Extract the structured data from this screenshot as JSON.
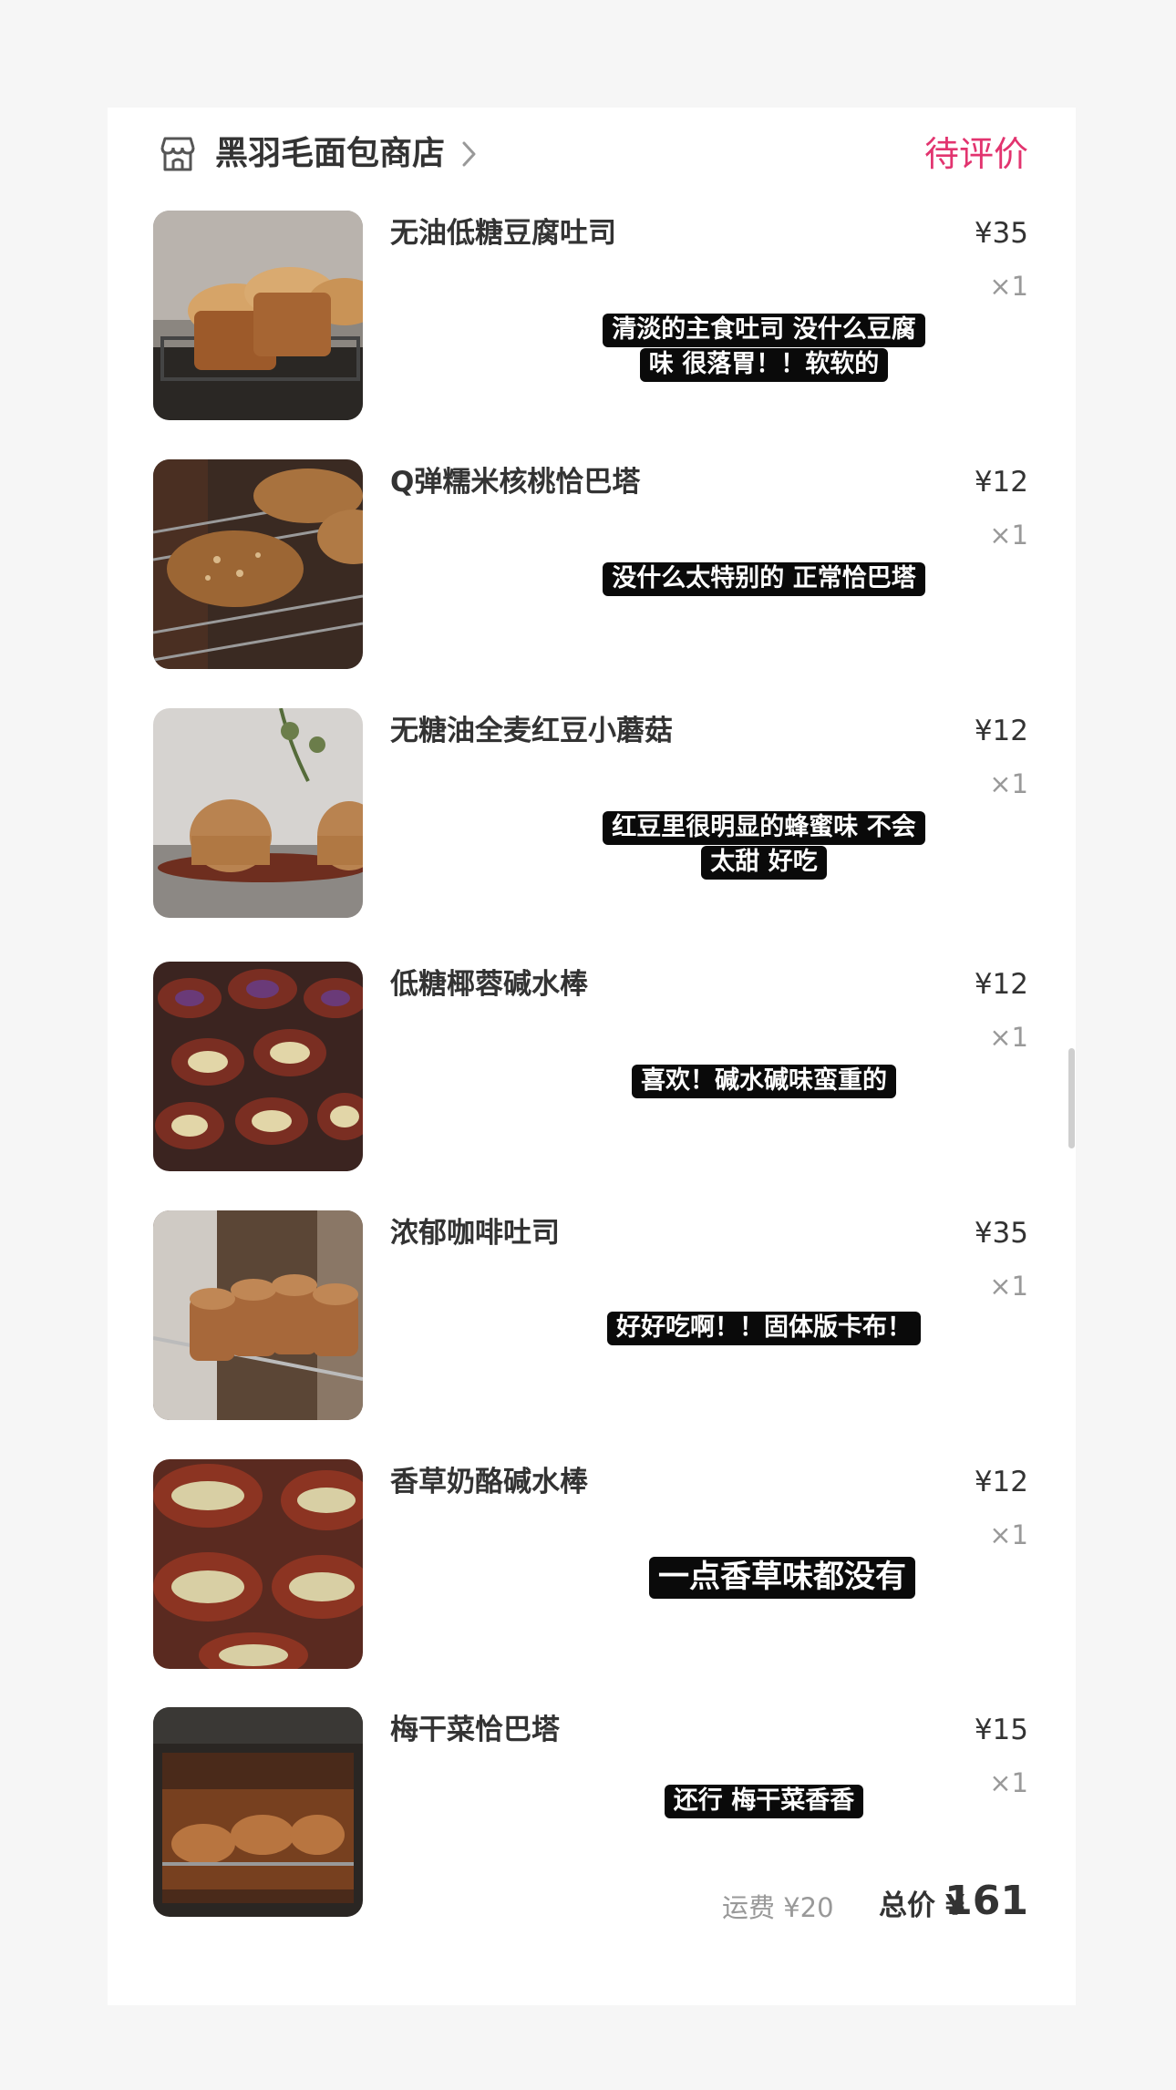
{
  "shop": {
    "name": "黑羽毛面包商店",
    "icon": "shop-icon",
    "status": "待评价",
    "status_color": "#e2346f"
  },
  "items": [
    {
      "name": "无油低糖豆腐吐司",
      "price": "¥35",
      "qty": "×1",
      "caption_lines": [
        "清淡的主食吐司 没什么豆腐",
        "味 很落胃！！软软的"
      ]
    },
    {
      "name": "Q弹糯米核桃恰巴塔",
      "price": "¥12",
      "qty": "×1",
      "caption_lines": [
        "没什么太特别的 正常恰巴塔"
      ]
    },
    {
      "name": "无糖油全麦红豆小蘑菇",
      "price": "¥12",
      "qty": "×1",
      "caption_lines": [
        "红豆里很明显的蜂蜜味 不会",
        "太甜 好吃"
      ]
    },
    {
      "name": "低糖椰蓉碱水棒",
      "price": "¥12",
      "qty": "×1",
      "caption_lines": [
        "喜欢！碱水碱味蛮重的"
      ]
    },
    {
      "name": "浓郁咖啡吐司",
      "price": "¥35",
      "qty": "×1",
      "caption_lines": [
        "好好吃啊！！固体版卡布！"
      ]
    },
    {
      "name": "香草奶酪碱水棒",
      "price": "¥12",
      "qty": "×1",
      "caption_lines": [
        "一点香草味都没有"
      ]
    },
    {
      "name": "梅干菜恰巴塔",
      "price": "¥15",
      "qty": "×1",
      "caption_lines": [
        "还行 梅干菜香香"
      ]
    }
  ],
  "footer": {
    "shipping": "运费 ¥20",
    "total_label": "总价 ¥",
    "total_value": "161"
  }
}
